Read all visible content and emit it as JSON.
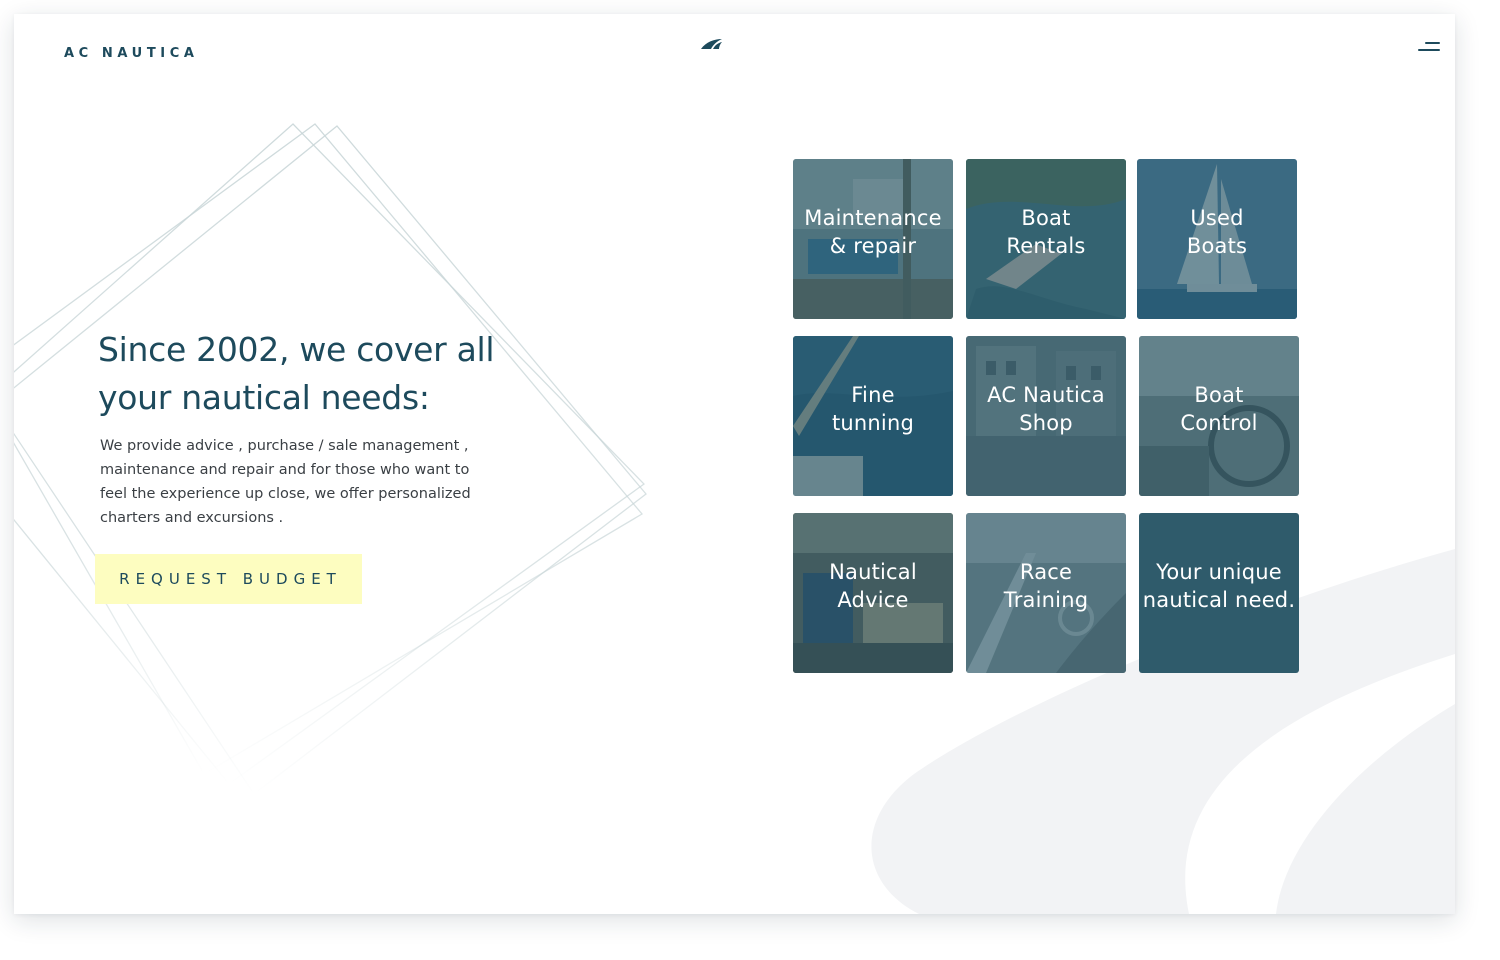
{
  "brand": {
    "name": "AC NAUTICA"
  },
  "header": {
    "logo_icon": "sail-logo-icon",
    "menu_icon": "hamburger-menu-icon"
  },
  "hero": {
    "title": "Since 2002, we cover all your nautical needs:",
    "description": "We provide advice ,  purchase / sale management , maintenance and repair and for those who want to feel the experience up close, we offer personalized charters and excursions .",
    "cta_label": "REQUEST BUDGET"
  },
  "services": [
    {
      "label": "Maintenance\n& repair"
    },
    {
      "label": "Boat\nRentals"
    },
    {
      "label": "Used\nBoats"
    },
    {
      "label": "Fine\ntunning"
    },
    {
      "label": "AC Nautica\nShop"
    },
    {
      "label": "Boat\nControl"
    },
    {
      "label": "Nautical\nAdvice"
    },
    {
      "label": "Race\nTraining"
    },
    {
      "label": "Your unique\nnautical need."
    }
  ],
  "colors": {
    "primary": "#1d4a5c",
    "cta_background": "#fdfdc0",
    "tile_overlay": "#2f5b6b",
    "background_shape": "#f2f3f5"
  }
}
